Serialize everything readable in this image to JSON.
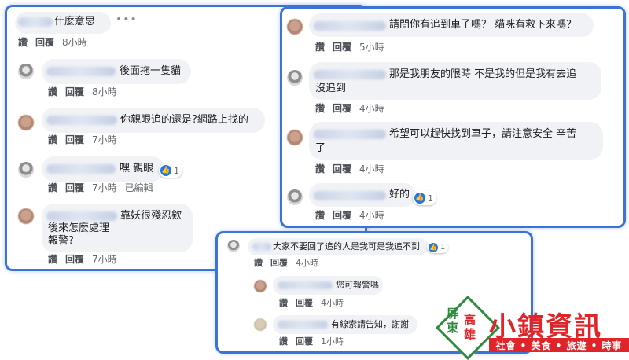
{
  "panel_left": {
    "top_comment_text": "什麼意思",
    "comments": [
      {
        "text": "後面拖一隻貓",
        "like": "讚",
        "reply": "回覆",
        "time": "8小時",
        "edited": ""
      },
      {
        "text": "你親眼追的還是?網路上找的",
        "like": "讚",
        "reply": "回覆",
        "time": "7小時",
        "edited": ""
      },
      {
        "text": "嘿 親眼",
        "like": "讚",
        "reply": "回覆",
        "time": "7小時",
        "edited": "已編輯",
        "reactions": "1"
      },
      {
        "text_line1": "靠妖很殘忍欸",
        "text_line2": "後來怎麼處理",
        "text_line3": "報警?",
        "like": "讚",
        "reply": "回覆",
        "time": "7小時",
        "edited": ""
      }
    ],
    "top_actions": {
      "like": "讚",
      "reply": "回覆",
      "time": "8小時"
    },
    "more_icon": "•••"
  },
  "panel_right": {
    "comments": [
      {
        "text": "請問你有追到車子嗎？ 貓咪有救下來嗎？",
        "like": "讚",
        "reply": "回覆",
        "time": "5小時"
      },
      {
        "text_line1": "那是我朋友的限時 不是我的但是我有去追",
        "text_line2": "沒追到",
        "like": "讚",
        "reply": "回覆",
        "time": "4小時"
      },
      {
        "text_line1": "希望可以趕快找到車子，請注意安全 辛苦",
        "text_line2": "了",
        "like": "讚",
        "reply": "回覆",
        "time": "4小時"
      },
      {
        "text": "好的",
        "like": "讚",
        "reply": "回覆",
        "time": "4小時",
        "reactions": "1"
      }
    ]
  },
  "panel_bottom": {
    "comments": [
      {
        "text": "大家不要回了追的人是我可是我追不到",
        "like": "讚",
        "reply": "回覆",
        "time": "4小時",
        "reactions": "1"
      },
      {
        "text": "您可報警嗎",
        "like": "讚",
        "reply": "回覆",
        "time": "4小時"
      },
      {
        "text": "有線索請告知，謝謝",
        "like": "讚",
        "reply": "回覆",
        "time": "1小時"
      }
    ]
  },
  "logo": {
    "region_chars": [
      "屏",
      "東",
      "高",
      "雄"
    ],
    "name": "小鎮資訊",
    "tagline": "社會 • 美食 • 旅遊 • 時事"
  },
  "colors": {
    "panel_border": "#3b73d6",
    "bubble": "#f0f2f5",
    "like_blue": "#1877f2",
    "logo_red": "#e0252a",
    "logo_green": "#2e8b3e"
  }
}
